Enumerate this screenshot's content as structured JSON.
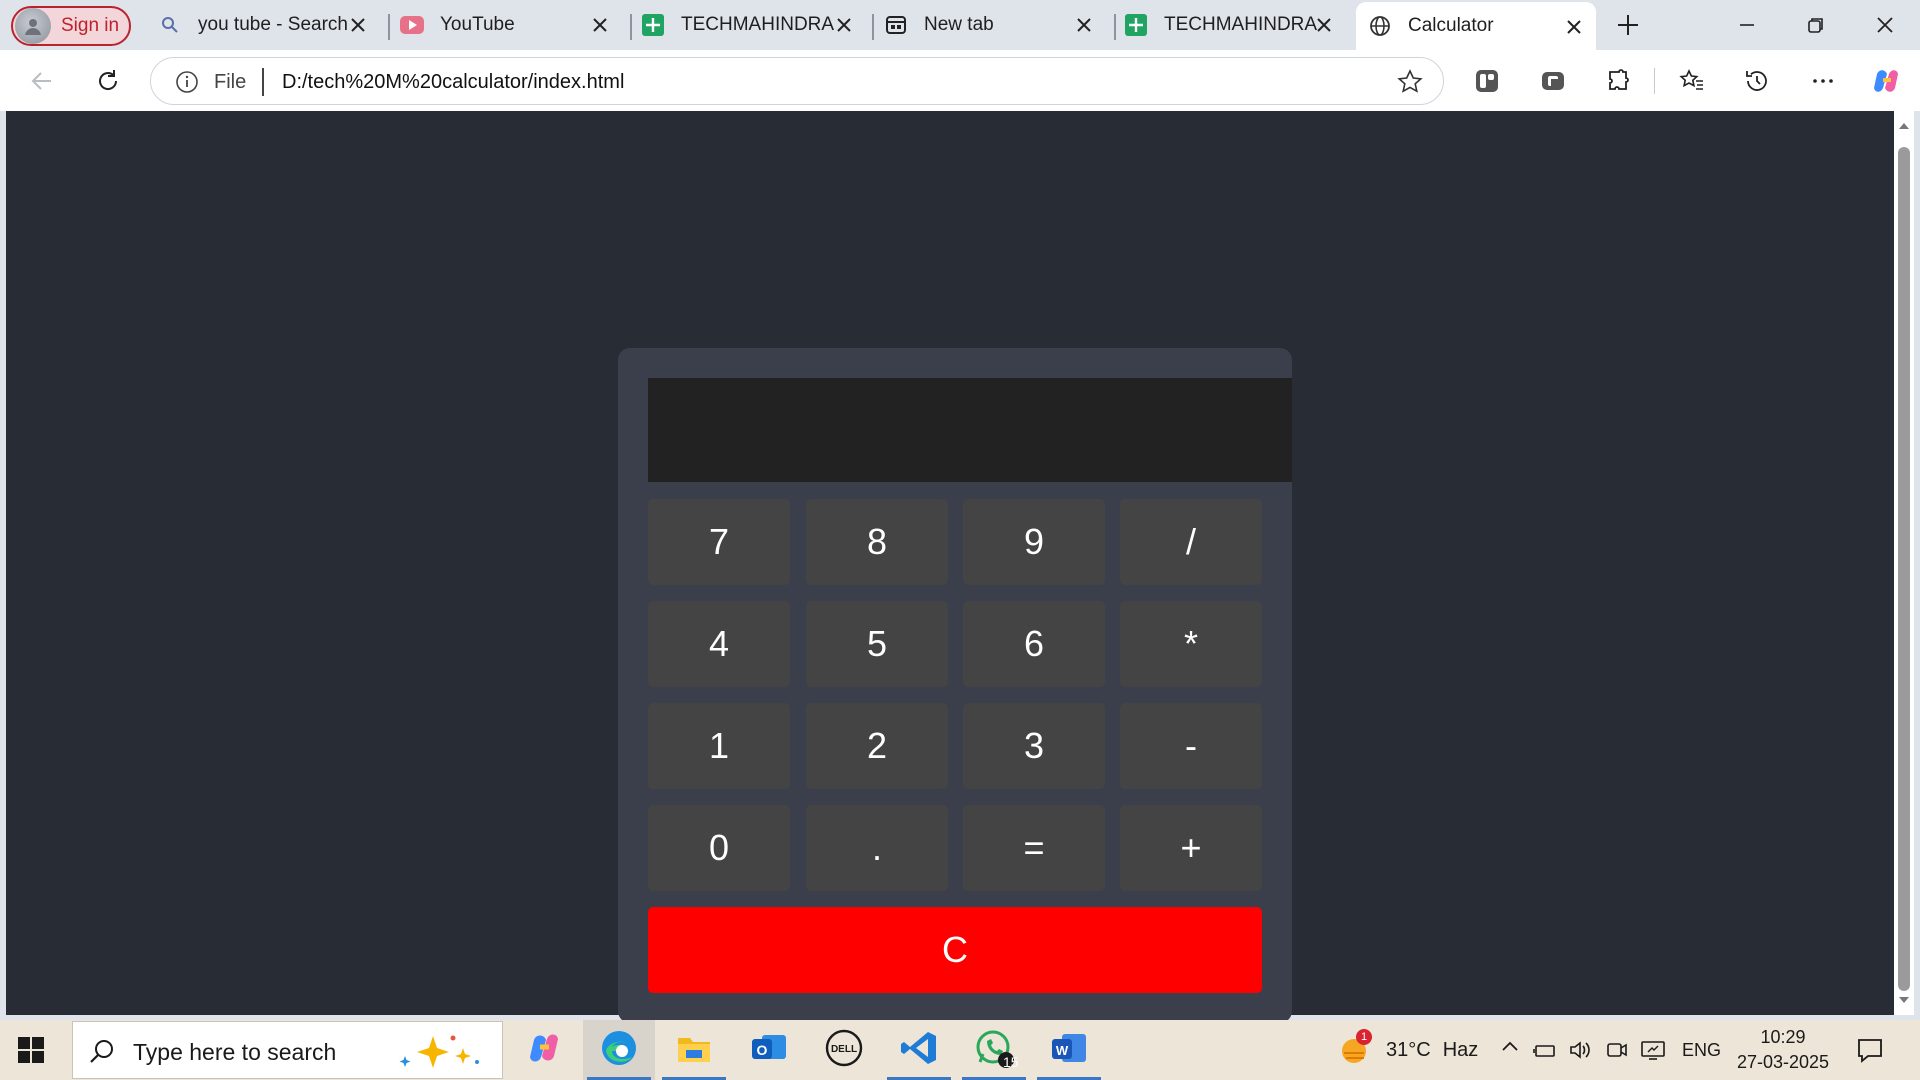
{
  "browser": {
    "profile": {
      "label": "Sign in"
    },
    "tabs": [
      {
        "title": "you tube - Search",
        "icon": "search-icon"
      },
      {
        "title": "YouTube",
        "icon": "youtube-icon"
      },
      {
        "title": "TECHMAHINDRA C",
        "icon": "google-sheets-icon"
      },
      {
        "title": "New tab",
        "icon": "new-tab-icon"
      },
      {
        "title": "TECHMAHINDRA C",
        "icon": "google-sheets-icon"
      },
      {
        "title": "Calculator",
        "icon": "globe-icon",
        "active": true
      }
    ],
    "address": {
      "scheme": "File",
      "url": "D:/tech%20M%20calculator/index.html"
    }
  },
  "calculator": {
    "display_value": "",
    "keys": [
      [
        "7",
        "8",
        "9",
        "/"
      ],
      [
        "4",
        "5",
        "6",
        "*"
      ],
      [
        "1",
        "2",
        "3",
        "-"
      ],
      [
        "0",
        ".",
        "=",
        "+"
      ]
    ],
    "clear_label": "C",
    "colors": {
      "page_bg": "#282c34",
      "panel": "#3a3f4b",
      "display": "#222222",
      "key": "#444444",
      "clear": "#ff0000"
    }
  },
  "taskbar": {
    "search_placeholder": "Type here to search",
    "apps": [
      "copilot-icon",
      "edge-icon",
      "file-explorer-icon",
      "outlook-icon",
      "dell-icon",
      "vscode-icon",
      "whatsapp-icon",
      "word-icon"
    ],
    "whatsapp_badge": "15",
    "weather": {
      "temp": "31°C",
      "condition": "Haz",
      "badge": "1"
    },
    "language": "ENG",
    "time": "10:29",
    "date": "27-03-2025"
  }
}
